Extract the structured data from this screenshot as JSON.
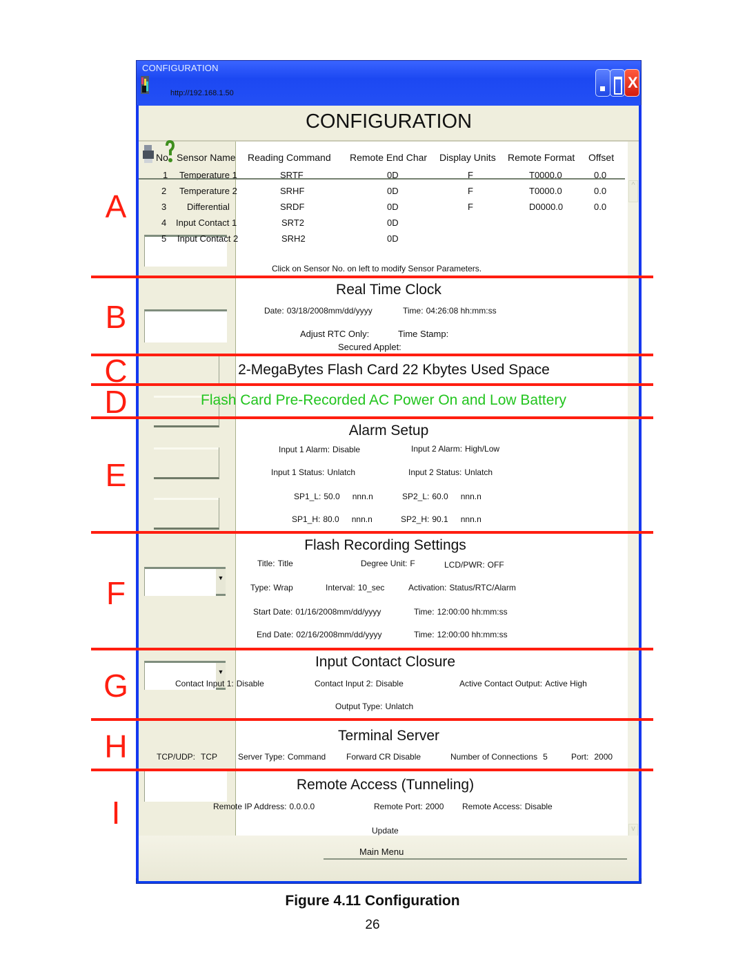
{
  "window": {
    "title": "CONFIGURATION",
    "url": "http://192.168.1.50",
    "controls": {
      "minimize": "minimize-icon",
      "maximize": "maximize-icon",
      "close": "close-icon",
      "close_glyph": "X"
    }
  },
  "page_title": "CONFIGURATION",
  "sensors": {
    "columns": [
      "No",
      "Sensor Name",
      "Reading Command",
      "Remote End Char",
      "Display Units",
      "Remote Format",
      "Offset"
    ],
    "rows": [
      {
        "no": "1",
        "name": "Temperature 1",
        "command": "SRTF",
        "end_char": "0D",
        "units": "F",
        "format": "T0000.0",
        "offset": "0.0"
      },
      {
        "no": "2",
        "name": "Temperature 2",
        "command": "SRHF",
        "end_char": "0D",
        "units": "F",
        "format": "T0000.0",
        "offset": "0.0"
      },
      {
        "no": "3",
        "name": "Differential",
        "command": "SRDF",
        "end_char": "0D",
        "units": "F",
        "format": "D0000.0",
        "offset": "0.0"
      },
      {
        "no": "4",
        "name": "Input Contact 1",
        "command": "SRT2",
        "end_char": "0D",
        "units": "",
        "format": "",
        "offset": ""
      },
      {
        "no": "5",
        "name": "Input Contact 2",
        "command": "SRH2",
        "end_char": "0D",
        "units": "",
        "format": "",
        "offset": ""
      }
    ],
    "hint": "Click on Sensor No. on left to modify Sensor Parameters."
  },
  "rtc": {
    "title": "Real Time Clock",
    "date_label": "Date:",
    "date_value": "03/18/2008",
    "date_format": "mm/dd/yyyy",
    "time_label": "Time:",
    "time_value": "04:26:08",
    "time_format": "hh:mm:ss",
    "adjust_label": "Adjust RTC Only:",
    "timestamp_label": "Time Stamp:",
    "secured_label": "Secured Applet:"
  },
  "flash_card": {
    "usage": "2-MegaBytes Flash Card 22 Kbytes Used Space",
    "prerecorded": "Flash Card Pre-Recorded AC Power On and Low Battery",
    "prerecorded_color": "#22c41e"
  },
  "alarm": {
    "title": "Alarm Setup",
    "input1_alarm_label": "Input 1 Alarm:",
    "input1_alarm": "Disable",
    "input2_alarm_label": "Input 2 Alarm:",
    "input2_alarm": "High/Low",
    "input1_status_label": "Input 1 Status:",
    "input1_status": "Unlatch",
    "input2_status_label": "Input 2 Status:",
    "input2_status": "Unlatch",
    "sp1_l_label": "SP1_L:",
    "sp1_l": "50.0",
    "sp2_l_label": "SP2_L:",
    "sp2_l": "60.0",
    "sp1_h_label": "SP1_H:",
    "sp1_h": "80.0",
    "sp2_h_label": "SP2_H:",
    "sp2_h": "90.1",
    "unit_format": "nnn.n"
  },
  "recording": {
    "title": "Flash Recording Settings",
    "title_label": "Title:",
    "title_value": "Title",
    "degree_label": "Degree Unit:",
    "degree_value": "F",
    "lcd_label": "LCD/PWR:",
    "lcd_value": "OFF",
    "type_label": "Type:",
    "type_value": "Wrap",
    "interval_label": "Interval:",
    "interval_value": "10_sec",
    "activation_label": "Activation:",
    "activation_value": "Status/RTC/Alarm",
    "start_label": "Start Date:",
    "start_value": "01/16/2008",
    "date_format": "mm/dd/yyyy",
    "start_time_label": "Time:",
    "start_time": "12:00:00",
    "time_format": "hh:mm:ss",
    "end_label": "End Date:",
    "end_value": "02/16/2008",
    "end_time_label": "Time:",
    "end_time": "12:00:00"
  },
  "contact": {
    "title": "Input Contact Closure",
    "input1_label": "Contact Input 1:",
    "input1_value": "Disable",
    "input2_label": "Contact Input 2:",
    "input2_value": "Disable",
    "active_label": "Active Contact Output:",
    "active_value": "Active High",
    "output_type_label": "Output Type:",
    "output_type_value": "Unlatch"
  },
  "terminal": {
    "title": "Terminal Server",
    "protocol_label": "TCP/UDP:",
    "protocol_value": "TCP",
    "server_type_label": "Server Type:",
    "server_type_value": "Command",
    "forward_cr": "Forward CR Disable",
    "connections_label": "Number of Connections",
    "connections_value": "5",
    "port_label": "Port:",
    "port_value": "2000"
  },
  "remote": {
    "title": "Remote Access (Tunneling)",
    "ip_label": "Remote IP Address:",
    "ip_value": "0.0.0.0",
    "port_label": "Remote Port:",
    "port_value": "2000",
    "access_label": "Remote Access:",
    "access_value": "Disable"
  },
  "actions": {
    "update": "Update",
    "main_menu": "Main Menu"
  },
  "annotations": {
    "letters": [
      "A",
      "B",
      "C",
      "D",
      "E",
      "F",
      "G",
      "H",
      "I"
    ],
    "color": "#ff1e10"
  },
  "caption": "Figure 4.11  Configuration",
  "page_number": "26"
}
